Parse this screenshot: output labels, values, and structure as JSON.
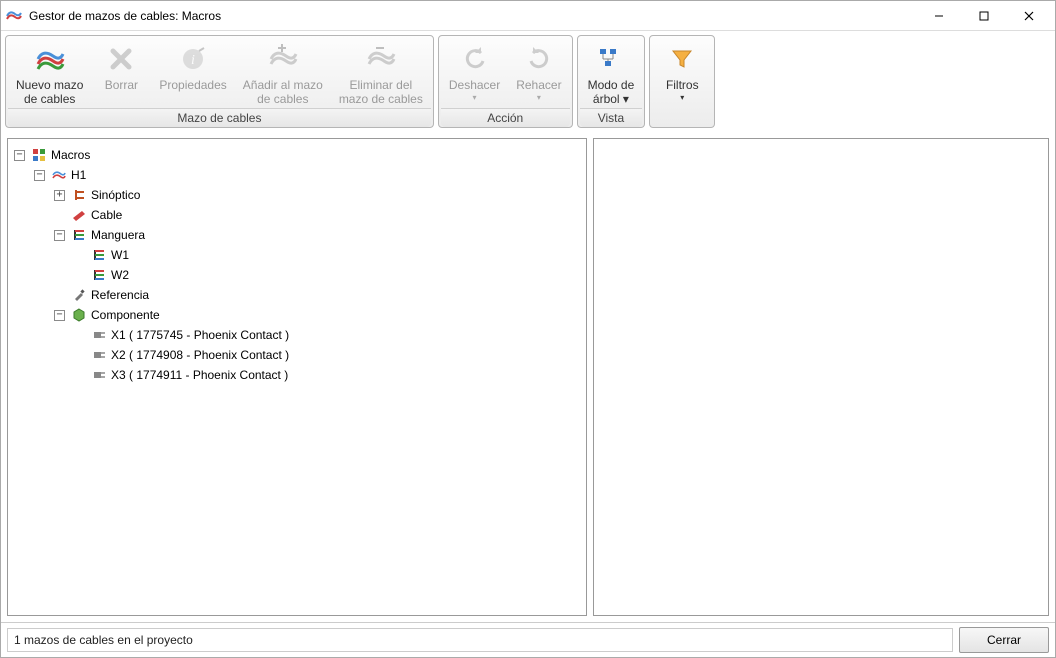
{
  "window": {
    "title": "Gestor de mazos de cables: Macros"
  },
  "ribbon": {
    "groups": [
      {
        "title": "Mazo de cables",
        "buttons": [
          {
            "id": "new-harness",
            "label": "Nuevo mazo\nde cables",
            "enabled": true,
            "icon": "harness-icon"
          },
          {
            "id": "delete",
            "label": "Borrar",
            "enabled": false,
            "icon": "delete-icon"
          },
          {
            "id": "properties",
            "label": "Propiedades",
            "enabled": false,
            "icon": "properties-icon"
          },
          {
            "id": "add-to-harness",
            "label": "Añadir al mazo\nde cables",
            "enabled": false,
            "icon": "add-harness-icon"
          },
          {
            "id": "remove-from-harness",
            "label": "Eliminar del\nmazo de cables",
            "enabled": false,
            "icon": "remove-harness-icon"
          }
        ]
      },
      {
        "title": "Acción",
        "buttons": [
          {
            "id": "undo",
            "label": "Deshacer",
            "enabled": false,
            "icon": "undo-icon",
            "dropdown": true
          },
          {
            "id": "redo",
            "label": "Rehacer",
            "enabled": false,
            "icon": "redo-icon",
            "dropdown": true
          }
        ]
      },
      {
        "title": "Vista",
        "buttons": [
          {
            "id": "tree-mode",
            "label": "Modo de\nárbol",
            "enabled": true,
            "icon": "tree-mode-icon",
            "dropdown": true
          }
        ]
      },
      {
        "title": "",
        "buttons": [
          {
            "id": "filters",
            "label": "Filtros",
            "enabled": true,
            "icon": "filter-icon",
            "dropdown": true
          }
        ]
      }
    ]
  },
  "tree": {
    "root": {
      "label": "Macros",
      "icon": "macros-icon",
      "expanded": true,
      "children": [
        {
          "label": "H1",
          "icon": "harness-icon",
          "expanded": true,
          "children": [
            {
              "label": "Sinóptico",
              "icon": "synoptic-icon",
              "expanded": false,
              "hasChildren": true
            },
            {
              "label": "Cable",
              "icon": "cable-icon"
            },
            {
              "label": "Manguera",
              "icon": "sleeve-icon",
              "expanded": true,
              "children": [
                {
                  "label": "W1",
                  "icon": "sleeve-item-icon"
                },
                {
                  "label": "W2",
                  "icon": "sleeve-item-icon"
                }
              ]
            },
            {
              "label": "Referencia",
              "icon": "reference-icon"
            },
            {
              "label": "Componente",
              "icon": "component-icon",
              "expanded": true,
              "children": [
                {
                  "label": "X1 ( 1775745 - Phoenix Contact )",
                  "icon": "connector-icon"
                },
                {
                  "label": "X2 ( 1774908 - Phoenix Contact )",
                  "icon": "connector-icon"
                },
                {
                  "label": "X3 ( 1774911 - Phoenix Contact )",
                  "icon": "connector-icon"
                }
              ]
            }
          ]
        }
      ]
    }
  },
  "status": {
    "text": "1 mazos de cables en el proyecto",
    "close_label": "Cerrar"
  }
}
